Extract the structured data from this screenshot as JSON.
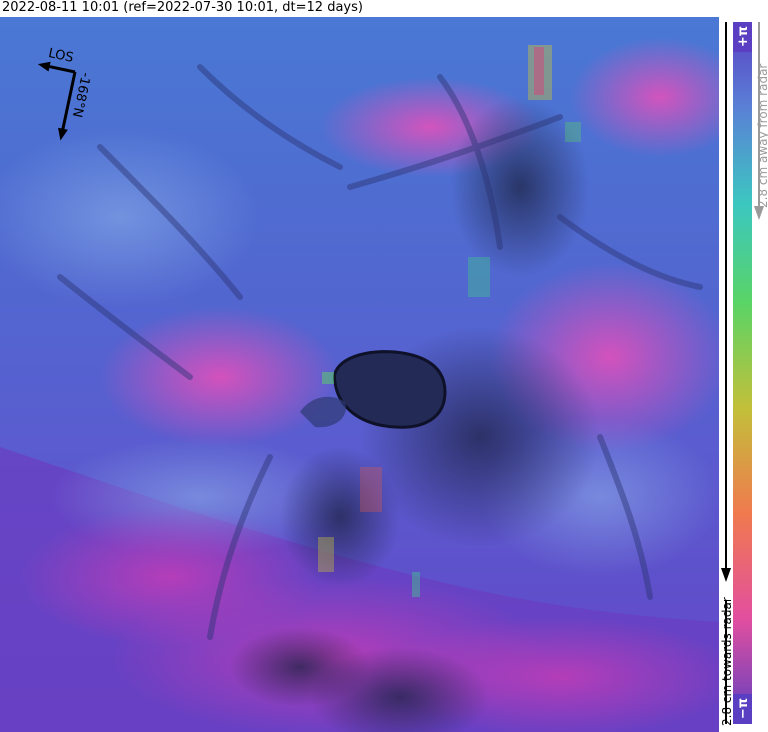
{
  "title": "2022-08-11 10:01 (ref=2022-07-30 10:01, dt=12 days)",
  "compass": {
    "los_label": "LOS",
    "heading_label": "-168°N"
  },
  "colorbar": {
    "top_label": "+π",
    "bottom_label": "−π",
    "away_label": "2.8 cm away from radar",
    "towards_label": "2.8 cm towards radar",
    "colors": {
      "top": "#5b3fc2",
      "upper": "#5a7fd6",
      "mid_cyan": "#3cc7c0",
      "mid_green": "#59d466",
      "mid_yellow": "#c2c03a",
      "mid_orange": "#f07a4e",
      "lower": "#e24f9f",
      "bottom": "#5b3fc2"
    }
  },
  "map": {
    "background": "#4f6fd0",
    "crater_color": "#1e2240",
    "deformation_color": "#d44cc6"
  }
}
